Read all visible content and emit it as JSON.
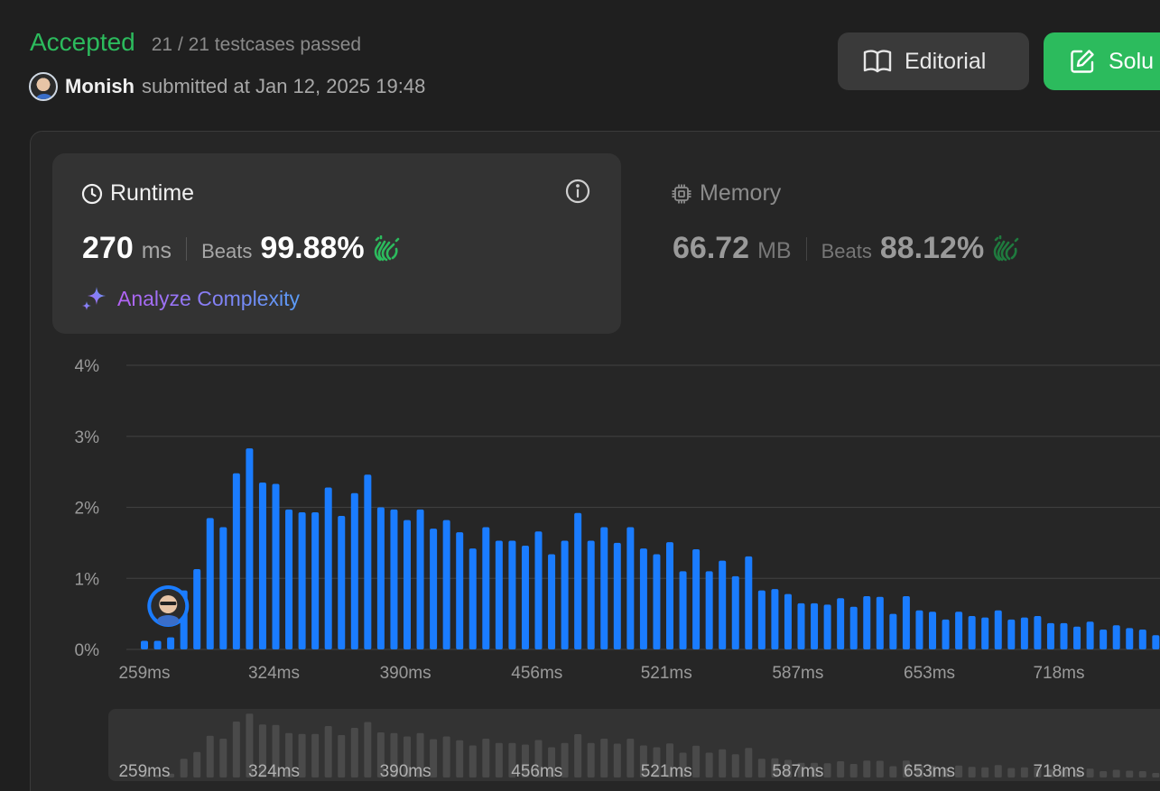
{
  "header": {
    "status": "Accepted",
    "testcases": "21 / 21 testcases passed",
    "user": "Monish",
    "submitted": "submitted at Jan 12, 2025 19:48",
    "editorial_label": "Editorial",
    "solution_label": "Solu"
  },
  "runtime": {
    "title": "Runtime",
    "value": "270",
    "unit": "ms",
    "beats_label": "Beats",
    "beats_value": "99.88%",
    "analyze_label": "Analyze Complexity"
  },
  "memory": {
    "title": "Memory",
    "value": "66.72",
    "unit": "MB",
    "beats_label": "Beats",
    "beats_value": "88.12%"
  },
  "colors": {
    "accent_green": "#2cbb5d",
    "bar_blue": "#1a7cff",
    "mini_bar": "#4a4a4a"
  },
  "chart_data": {
    "type": "bar",
    "title": "",
    "xlabel": "",
    "ylabel": "",
    "ylim": [
      0,
      4
    ],
    "y_ticks": [
      "0%",
      "1%",
      "2%",
      "3%",
      "4%"
    ],
    "x_tick_labels": [
      "259ms",
      "324ms",
      "390ms",
      "456ms",
      "521ms",
      "587ms",
      "653ms",
      "718ms"
    ],
    "x_range_ms": [
      259,
      740
    ],
    "user_marker_ms": 270,
    "grid": true,
    "values": [
      0.12,
      0.12,
      0.17,
      0.83,
      1.13,
      1.85,
      1.72,
      2.48,
      2.83,
      2.35,
      2.33,
      1.97,
      1.93,
      1.93,
      2.28,
      1.88,
      2.2,
      2.46,
      2.0,
      1.97,
      1.82,
      1.97,
      1.7,
      1.82,
      1.65,
      1.42,
      1.72,
      1.53,
      1.53,
      1.46,
      1.66,
      1.34,
      1.53,
      1.92,
      1.53,
      1.72,
      1.5,
      1.72,
      1.42,
      1.34,
      1.51,
      1.1,
      1.41,
      1.1,
      1.25,
      1.03,
      1.31,
      0.83,
      0.85,
      0.78,
      0.65,
      0.65,
      0.63,
      0.72,
      0.6,
      0.75,
      0.74,
      0.5,
      0.75,
      0.55,
      0.53,
      0.42,
      0.53,
      0.47,
      0.45,
      0.55,
      0.42,
      0.45,
      0.47,
      0.37,
      0.37,
      0.32,
      0.39,
      0.28,
      0.34,
      0.3,
      0.28,
      0.2
    ]
  }
}
